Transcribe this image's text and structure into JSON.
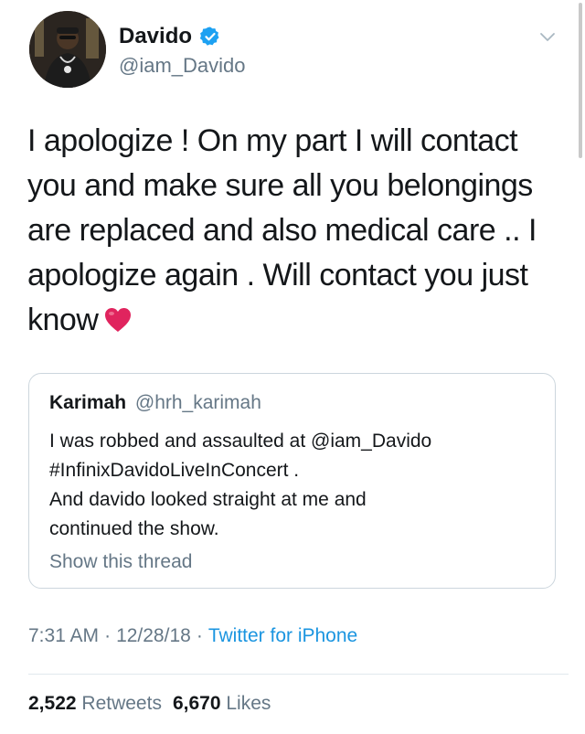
{
  "author": {
    "name": "Davido",
    "handle": "@iam_Davido",
    "verified": true,
    "avatar_icon": "avatar-photo"
  },
  "tweet": {
    "lines": [
      "I apologize ! On my part I will contact",
      "you and make sure all you belongings",
      "are replaced and also medical care .. I",
      "apologize again . Will contact you just",
      "know"
    ],
    "emoji": "heart-icon"
  },
  "quote": {
    "name": "Karimah",
    "handle": "@hrh_karimah",
    "lines": [
      "I was robbed and assaulted at @iam_Davido",
      "#InfinixDavidoLiveInConcert .",
      "And davido looked straight at me and",
      "continued the show."
    ],
    "show_thread": "Show this thread"
  },
  "meta": {
    "time": "7:31 AM",
    "date": "12/28/18",
    "source": "Twitter for iPhone",
    "separator": "·"
  },
  "stats": {
    "retweets_count": "2,522",
    "retweets_label": "Retweets",
    "likes_count": "6,670",
    "likes_label": "Likes"
  },
  "colors": {
    "text": "#14171a",
    "secondary": "#657786",
    "link": "#1b95e0",
    "verified": "#1da1f2",
    "heart": "#e0245e",
    "border": "#ccd6dd"
  }
}
